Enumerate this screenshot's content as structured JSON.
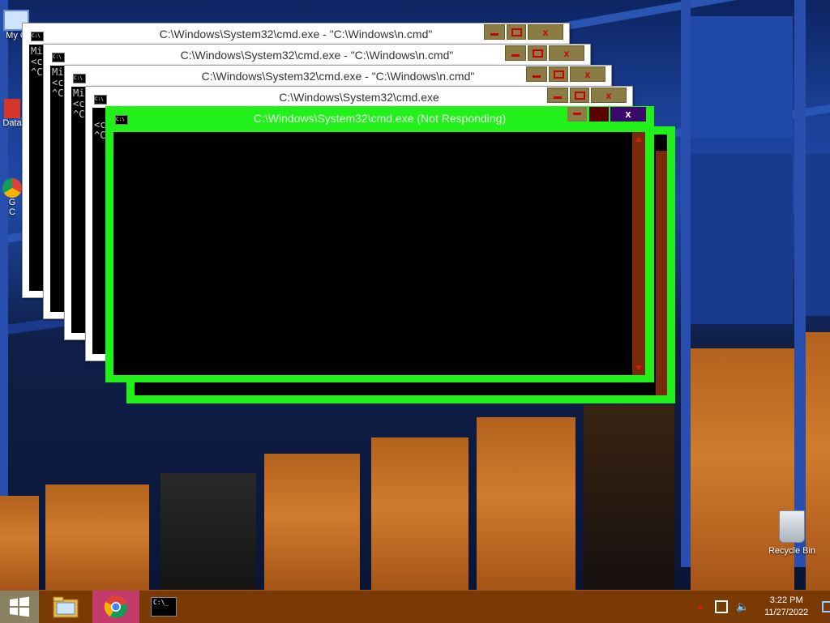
{
  "desktop": {
    "icons": [
      {
        "label": "My C"
      },
      {
        "label": "Data"
      },
      {
        "label": "G"
      },
      {
        "label": "C"
      }
    ],
    "recycle_bin": {
      "label": "Recycle Bin"
    }
  },
  "windows": [
    {
      "title": "C:\\Windows\\System32\\cmd.exe - \"C:\\Windows\\n.cmd\"",
      "console": "Mi\n<c\n^C"
    },
    {
      "title": "C:\\Windows\\System32\\cmd.exe - \"C:\\Windows\\n.cmd\"",
      "console": "Mi\n<c\n^C"
    },
    {
      "title": "C:\\Windows\\System32\\cmd.exe - \"C:\\Windows\\n.cmd\"",
      "console": "Mi\n<c\n^C"
    },
    {
      "title": "C:\\Windows\\System32\\cmd.exe",
      "console": "\n<c\n^C"
    }
  ],
  "front_window": {
    "title": "C:\\Windows\\System32\\cmd.exe (Not Responding)",
    "close_glyph": "x"
  },
  "button_glyphs": {
    "close": "x"
  },
  "taskbar": {
    "clock_time": "3:22 PM",
    "clock_date": "11/27/2022",
    "cmd_icon_text": "C:\\_"
  },
  "icons": [
    "windows-start-icon",
    "file-explorer-icon",
    "chrome-icon",
    "cmd-icon",
    "network-icon",
    "speaker-icon",
    "show-desktop-icon",
    "tray-arrow-icon"
  ],
  "colors": {
    "front_frame": "#22f01a",
    "taskbar": "#7a3a06",
    "button_face": "#8a7c45"
  }
}
